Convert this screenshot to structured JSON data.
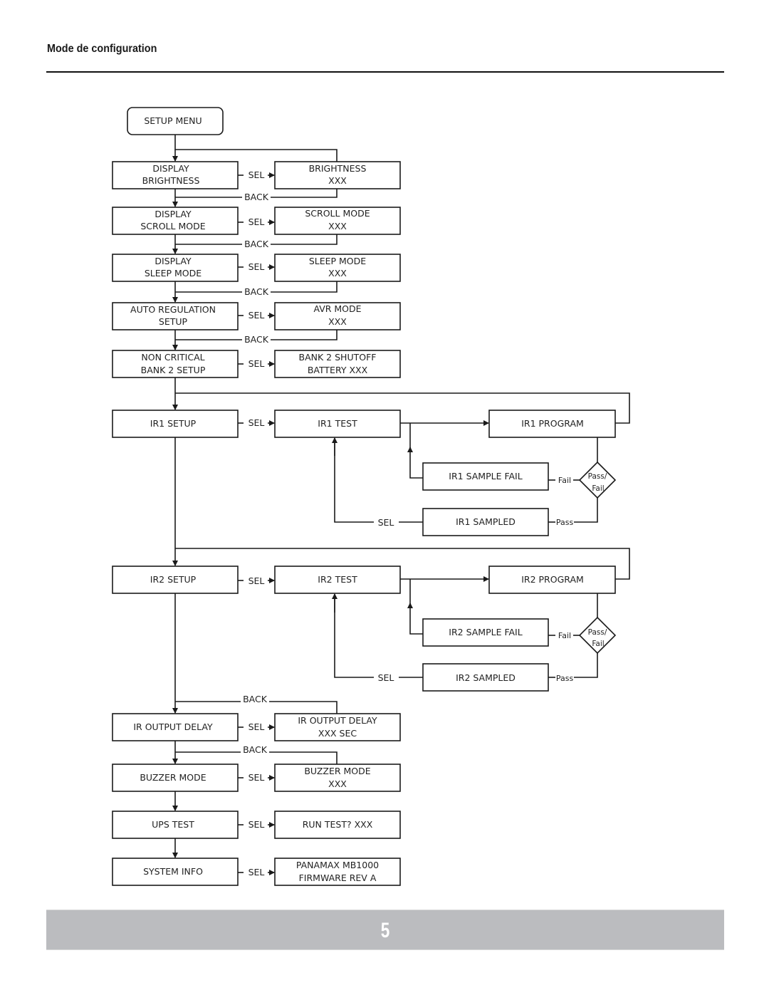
{
  "page": {
    "title": "Mode de configuration",
    "page_number": "5"
  },
  "start": {
    "label": "SETUP MENU"
  },
  "menu": [
    {
      "line1": "DISPLAY",
      "line2": "BRIGHTNESS",
      "sub1": "BRIGHTNESS",
      "sub2": "XXX"
    },
    {
      "line1": "DISPLAY",
      "line2": "SCROLL MODE",
      "sub1": "SCROLL MODE",
      "sub2": "XXX"
    },
    {
      "line1": "DISPLAY",
      "line2": "SLEEP MODE",
      "sub1": "SLEEP MODE",
      "sub2": "XXX"
    },
    {
      "line1": "AUTO REGULATION",
      "line2": "SETUP",
      "sub1": "AVR MODE",
      "sub2": "XXX"
    },
    {
      "line1": "NON CRITICAL",
      "line2": "BANK 2 SETUP",
      "sub1": "BANK 2 SHUTOFF",
      "sub2": "BATTERY XXX"
    }
  ],
  "ir": [
    {
      "setup": "IR1 SETUP",
      "test": "IR1 TEST",
      "program": "IR1 PROGRAM",
      "sample_fail": "IR1 SAMPLE FAIL",
      "sampled": "IR1 SAMPLED"
    },
    {
      "setup": "IR2 SETUP",
      "test": "IR2 TEST",
      "program": "IR2 PROGRAM",
      "sample_fail": "IR2 SAMPLE FAIL",
      "sampled": "IR2 SAMPLED"
    }
  ],
  "decision": {
    "line1": "Pass/",
    "line2": "Fail",
    "fail": "Fail",
    "pass": "Pass"
  },
  "tail": [
    {
      "label": "IR OUTPUT DELAY",
      "sub1": "IR OUTPUT DELAY",
      "sub2": "XXX SEC"
    },
    {
      "label": "BUZZER MODE",
      "sub1": "BUZZER MODE",
      "sub2": "XXX"
    },
    {
      "label": "UPS TEST",
      "sub1": "RUN TEST? XXX",
      "sub2": ""
    },
    {
      "label": "SYSTEM INFO",
      "sub1": "PANAMAX MB1000",
      "sub2": "FIRMWARE REV A"
    }
  ],
  "connectors": {
    "sel": "SEL",
    "back": "BACK"
  }
}
